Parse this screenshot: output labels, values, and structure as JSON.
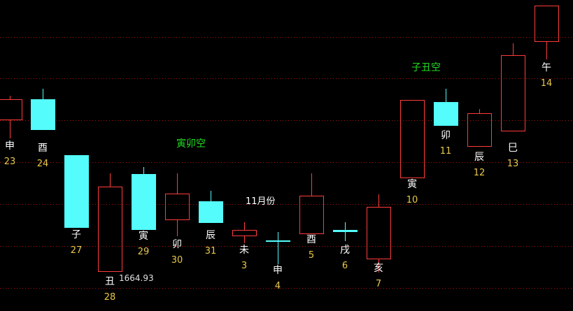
{
  "chart_data": {
    "type": "candlestick",
    "title": "",
    "colors": {
      "up": "#ff3c3c",
      "down": "#54fcfc",
      "branch_label": "#ffffff",
      "day_label": "#e8c84a",
      "annotation": "#22dd22",
      "grid": "#b01010",
      "background": "#000000"
    },
    "grid": true,
    "candles": [
      {
        "branch": "申",
        "day": "23",
        "open": 0,
        "high": 0,
        "low": 0,
        "close": 0
      },
      {
        "branch": "酉",
        "day": "24",
        "open": 0,
        "high": 0,
        "low": 0,
        "close": 0
      },
      {
        "branch": "子",
        "day": "27",
        "open": 0,
        "high": 0,
        "low": 0,
        "close": 0
      },
      {
        "branch": "丑",
        "day": "28",
        "open": 0,
        "high": 0,
        "low": 0,
        "close": 0
      },
      {
        "branch": "寅",
        "day": "29",
        "open": 0,
        "high": 0,
        "low": 0,
        "close": 0
      },
      {
        "branch": "卯",
        "day": "30",
        "open": 0,
        "high": 0,
        "low": 0,
        "close": 0
      },
      {
        "branch": "辰",
        "day": "31",
        "open": 0,
        "high": 0,
        "low": 0,
        "close": 0
      },
      {
        "branch": "未",
        "day": "3",
        "open": 0,
        "high": 0,
        "low": 0,
        "close": 0
      },
      {
        "branch": "申",
        "day": "4",
        "open": 0,
        "high": 0,
        "low": 0,
        "close": 0
      },
      {
        "branch": "酉",
        "day": "5",
        "open": 0,
        "high": 0,
        "low": 0,
        "close": 0
      },
      {
        "branch": "戌",
        "day": "6",
        "open": 0,
        "high": 0,
        "low": 0,
        "close": 0
      },
      {
        "branch": "亥",
        "day": "7",
        "open": 0,
        "high": 0,
        "low": 0,
        "close": 0
      },
      {
        "branch": "寅",
        "day": "10",
        "open": 0,
        "high": 0,
        "low": 0,
        "close": 0
      },
      {
        "branch": "卯",
        "day": "11",
        "open": 0,
        "high": 0,
        "low": 0,
        "close": 0
      },
      {
        "branch": "辰",
        "day": "12",
        "open": 0,
        "high": 0,
        "low": 0,
        "close": 0
      },
      {
        "branch": "巳",
        "day": "13",
        "open": 0,
        "high": 0,
        "low": 0,
        "close": 0
      },
      {
        "branch": "午",
        "day": "14",
        "open": 0,
        "high": 0,
        "low": 0,
        "close": 0
      }
    ],
    "annotations": [
      {
        "text": "寅卯空"
      },
      {
        "text": "子丑空"
      }
    ],
    "month_label": "11月份",
    "low_value_label": "1664.93"
  }
}
